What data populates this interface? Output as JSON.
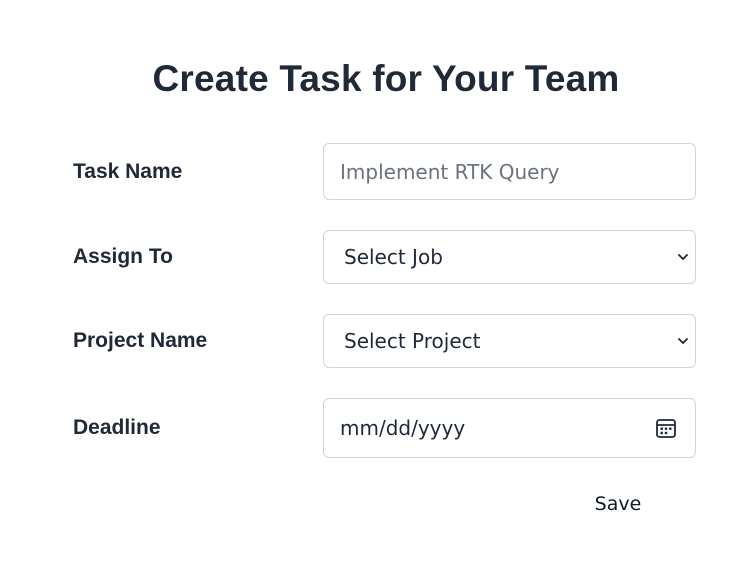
{
  "form": {
    "title": "Create Task for Your Team",
    "task_name": {
      "label": "Task Name",
      "placeholder": "Implement RTK Query",
      "value": ""
    },
    "assign_to": {
      "label": "Assign To",
      "selected": "Select Job"
    },
    "project_name": {
      "label": "Project Name",
      "selected": "Select Project"
    },
    "deadline": {
      "label": "Deadline",
      "placeholder": "mm/dd/yyyy",
      "icon": "calendar-icon"
    },
    "save_label": "Save"
  },
  "colors": {
    "text": "#1f2937",
    "placeholder": "#6b7280",
    "border": "#d1d5db",
    "background": "#ffffff"
  }
}
